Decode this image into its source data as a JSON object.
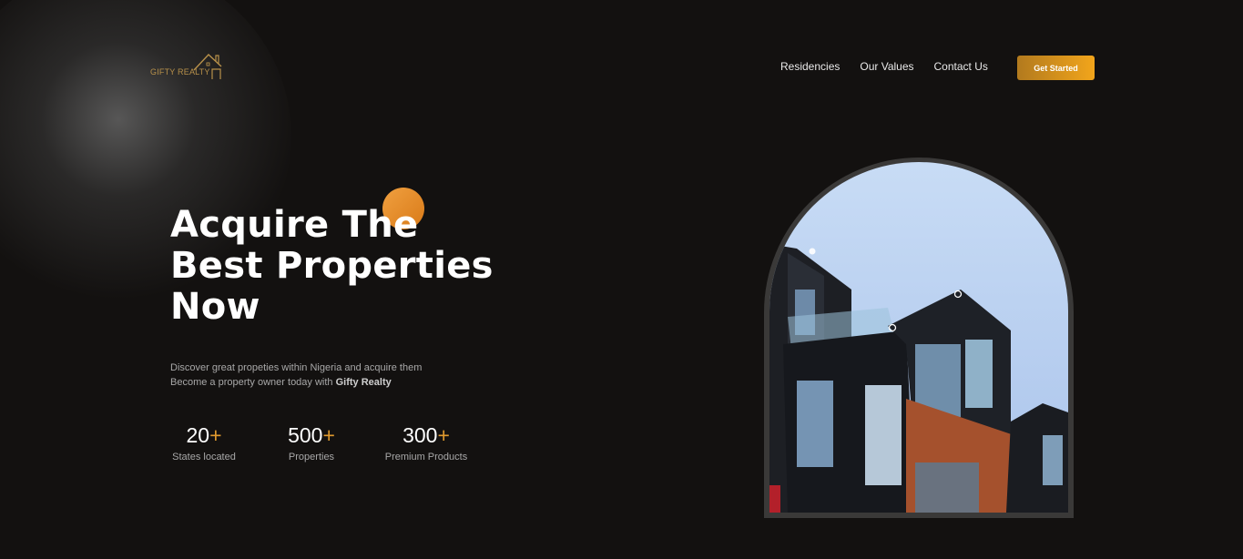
{
  "brand": {
    "name": "GIFTY REALTY",
    "accent_color": "#e09a2e"
  },
  "nav": {
    "items": [
      {
        "label": "Residencies"
      },
      {
        "label": "Our Values"
      },
      {
        "label": "Contact Us"
      }
    ],
    "cta_label": "Get Started"
  },
  "hero": {
    "title_lines": [
      "Acquire The",
      "Best Properties",
      "Now"
    ],
    "description_line1": "Discover great propeties within Nigeria and acquire them",
    "description_line2_prefix": "Become a property owner today with ",
    "description_line2_bold": "Gifty Realty",
    "stats": [
      {
        "value": "20",
        "suffix": "+",
        "label": "States located"
      },
      {
        "value": "500",
        "suffix": "+",
        "label": "Properties"
      },
      {
        "value": "300",
        "suffix": "+",
        "label": "Premium Products"
      }
    ],
    "image_icon": "building-photo"
  }
}
